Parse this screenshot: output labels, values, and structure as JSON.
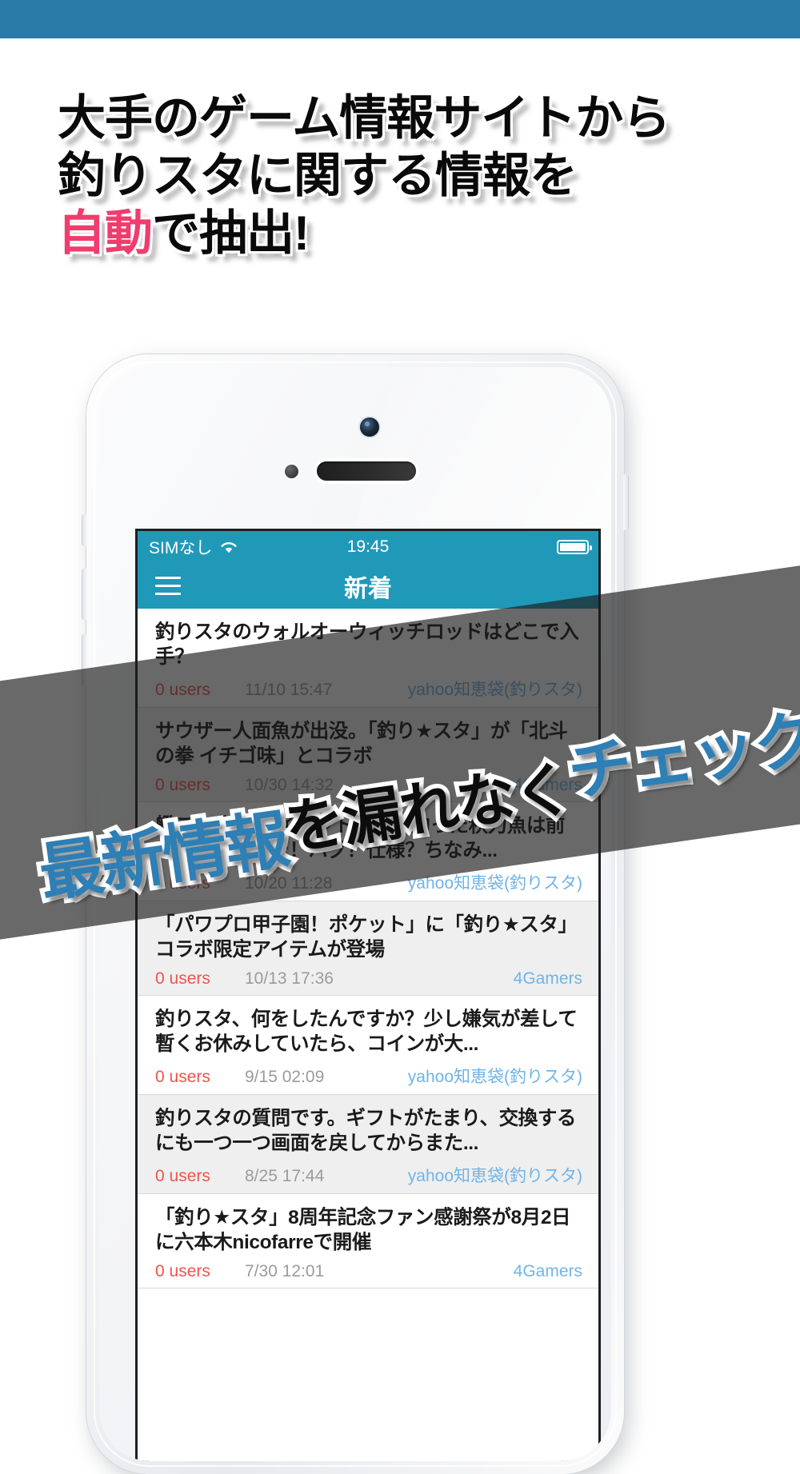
{
  "colors": {
    "top_strip": "#2a7ba8",
    "accent_pink": "#ef3d6d",
    "app_bar": "#2099b8",
    "users_red": "#f2534d",
    "source_blue": "#6fb4e8",
    "ribbon_blue": "#2d7fb5"
  },
  "headline": {
    "line1": "大手のゲーム情報サイトから",
    "line2": "釣りスタに関する情報を",
    "line3_pink": "自動",
    "line3_rest": "で抽出!"
  },
  "ribbon_headline": {
    "part1_blue": "最新情報",
    "part2_black": "を漏れなく",
    "part3_blue": "チェック",
    "part4_black": "!"
  },
  "phone": {
    "status_bar": {
      "carrier": "SIMなし",
      "wifi_icon": "wifi-icon",
      "time": "19:45",
      "battery_icon": "battery-full-icon"
    },
    "nav_bar": {
      "menu_icon": "hamburger-menu-icon",
      "title": "新着"
    },
    "list_items": [
      {
        "title": "釣りスタのウォルオーウィッチロッドはどこで入手？",
        "users": "0 users",
        "date": "11/10 15:47",
        "source": "yahoo知恵袋(釣りスタ)"
      },
      {
        "title": "サウザー人面魚が出没。「釣り★スタ」が「北斗の拳 イチゴ味」とコラボ",
        "users": "0 users",
        "date": "10/30 14:32",
        "source": "4Gamers"
      },
      {
        "title": "艦これ 秋刀魚イベント。私が釣った秋刀魚は前歯が出てました！バグ？仕様？ちなみ...",
        "users": "0 users",
        "date": "10/20 11:28",
        "source": "yahoo知恵袋(釣りスタ)"
      },
      {
        "title": "「パワプロ甲子園！ポケット」に「釣り★スタ」コラボ限定アイテムが登場",
        "users": "0 users",
        "date": "10/13 17:36",
        "source": "4Gamers"
      },
      {
        "title": "釣りスタ、何をしたんですか？少し嫌気が差して暫くお休みしていたら、コインが大...",
        "users": "0 users",
        "date": "9/15 02:09",
        "source": "yahoo知恵袋(釣りスタ)"
      },
      {
        "title": "釣りスタの質問です。ギフトがたまり、交換するにも一つ一つ画面を戻してからまた...",
        "users": "0 users",
        "date": "8/25 17:44",
        "source": "yahoo知恵袋(釣りスタ)"
      },
      {
        "title": "「釣り★スタ」8周年記念ファン感謝祭が8月2日に六本木nicofarreで開催",
        "users": "0 users",
        "date": "7/30 12:01",
        "source": "4Gamers"
      }
    ]
  }
}
